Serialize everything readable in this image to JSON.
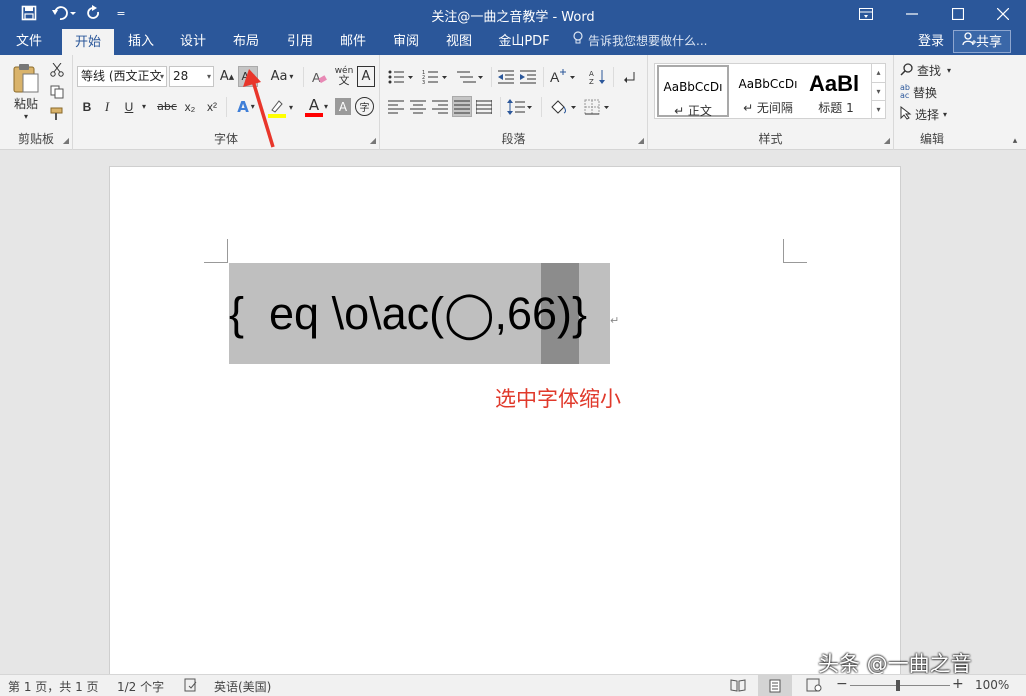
{
  "title_bar": {
    "window_title": "关注@一曲之音教学 - Word",
    "qat": {
      "dropdown": "="
    }
  },
  "tabs": {
    "file": "文件",
    "home": "开始",
    "insert": "插入",
    "design": "设计",
    "layout": "布局",
    "references": "引用",
    "mailings": "邮件",
    "review": "审阅",
    "view": "视图",
    "wps_pdf": "金山PDF",
    "tell_me": "告诉我您想要做什么...",
    "login": "登录",
    "share": "共享"
  },
  "ribbon": {
    "clipboard": {
      "paste_label": "粘贴",
      "group_label": "剪贴板"
    },
    "font": {
      "font_name": "等线 (西文正文",
      "font_size": "28",
      "group_label": "字体",
      "grow_font_glyph": "A",
      "shrink_font_glyph": "A",
      "change_case_glyph": "Aa",
      "phonetic_glyph": "wén",
      "bold": "B",
      "italic": "I",
      "underline": "U",
      "strikethrough": "abc",
      "subscript": "x₂",
      "superscript": "x²",
      "text_effects_glyph": "A",
      "font_color_glyph": "A",
      "char_shading_glyph": "A",
      "enclose_glyph": "字",
      "border_glyph": "A"
    },
    "paragraph": {
      "group_label": "段落"
    },
    "styles": {
      "group_label": "样式",
      "items": [
        {
          "preview": "AaBbCcDı",
          "name": "↵ 正文"
        },
        {
          "preview": "AaBbCcDı",
          "name": "↵ 无间隔"
        },
        {
          "preview": "AaBl",
          "name": "标题 1"
        }
      ]
    },
    "editing": {
      "group_label": "编辑",
      "find": "查找",
      "replace": "替换",
      "select": "选择"
    }
  },
  "document": {
    "field_code_text": "{  eq \\o\\ac(◯,66)}",
    "paragraph_mark": "↵",
    "annotation": "选中字体缩小"
  },
  "status_bar": {
    "page_info": "第 1 页，共 1 页",
    "word_count": "1/2 个字",
    "language": "英语(美国)",
    "zoom_minus": "−",
    "zoom_plus": "+",
    "zoom_level": "100%"
  },
  "watermark": "头条 @一曲之音",
  "colors": {
    "title_bar": "#2b579a",
    "ribbon_bg": "#f3f3f3",
    "annotation_red": "#e0392b",
    "highlight_yellow": "#ffff00",
    "font_color_red": "#ff0000"
  }
}
